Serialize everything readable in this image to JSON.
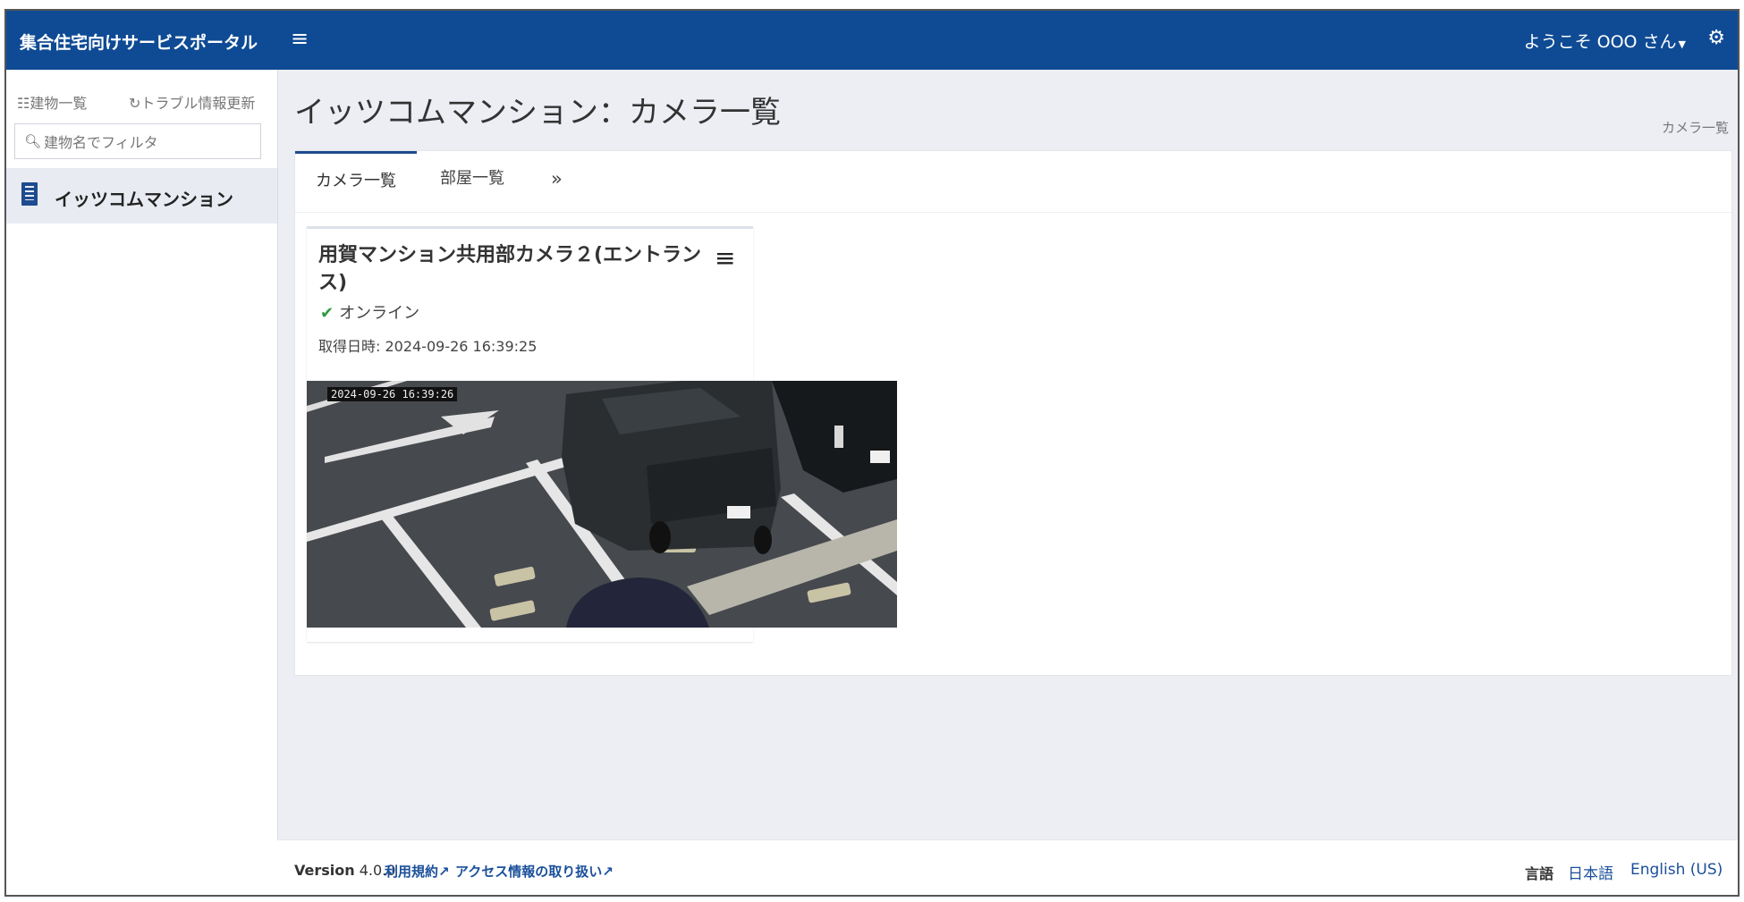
{
  "header": {
    "brand": "集合住宅向けサービスポータル",
    "menu_icon": "hamburger-icon",
    "user_greeting": "ようこそ OOO さん",
    "settings_icon": "gear-icon"
  },
  "sidebar": {
    "building_list_link": "☷建物一覧",
    "trouble_refresh_link": "↻トラブル情報更新",
    "filter_placeholder": "建物名でフィルタ",
    "filter_value": "",
    "items": [
      {
        "label": "イッツコムマンション",
        "icon": "building-icon"
      }
    ]
  },
  "page": {
    "title": "イッツコムマンション：カメラ一覧",
    "breadcrumb": "カメラ一覧"
  },
  "tabs": [
    {
      "label": "カメラ一覧",
      "active": true
    },
    {
      "label": "部屋一覧",
      "active": false
    },
    {
      "label": "»",
      "active": false
    }
  ],
  "camera_card": {
    "title": "用賀マンション共用部カメラ２(エントランス)",
    "status": "オンライン",
    "acquired_label": "取得日時: ",
    "acquired_at": "2024-09-26 16:39:25",
    "image_timestamp": "2024-09-26 16:39:26"
  },
  "footer": {
    "version_label": "Version",
    "version": "4.0.0",
    "terms_link": "利用規約",
    "access_link": "アクセス情報の取り扱い",
    "language_label": "言語",
    "languages": [
      "日本語",
      "English (US)"
    ]
  },
  "colors": {
    "header_bg": "#0f4b94",
    "link": "#1a4f9a",
    "online": "#2e9b3e",
    "tab_active": "#1d4b8f"
  }
}
